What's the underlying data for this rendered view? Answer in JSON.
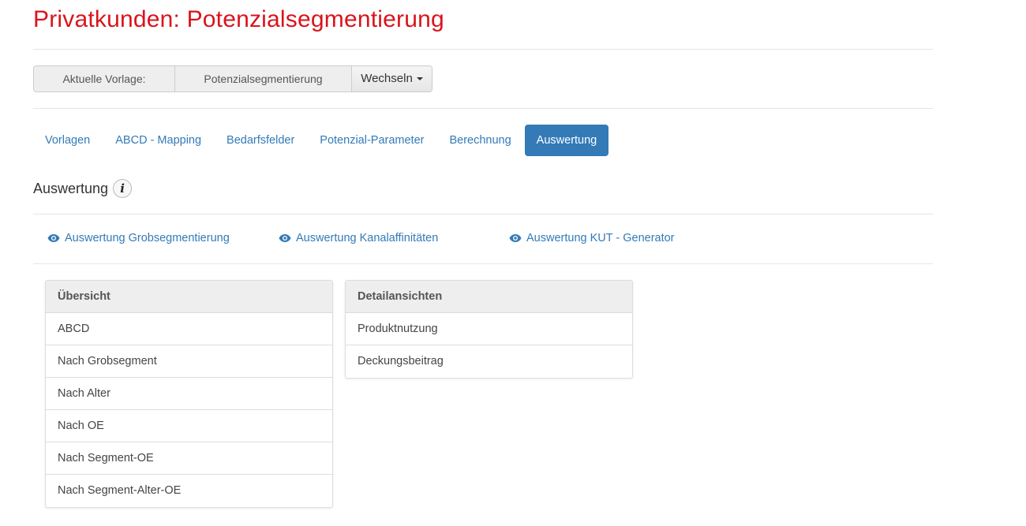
{
  "page_title": "Privatkunden: Potenzialsegmentierung",
  "template": {
    "label": "Aktuelle Vorlage:",
    "value": "Potenzialsegmentierung",
    "switch_label": "Wechseln"
  },
  "nav": {
    "items": [
      {
        "label": "Vorlagen",
        "active": false
      },
      {
        "label": "ABCD - Mapping",
        "active": false
      },
      {
        "label": "Bedarfsfelder",
        "active": false
      },
      {
        "label": "Potenzial-Parameter",
        "active": false
      },
      {
        "label": "Berechnung",
        "active": false
      },
      {
        "label": "Auswertung",
        "active": true
      }
    ]
  },
  "section": {
    "title": "Auswertung",
    "info_icon": "i"
  },
  "links": [
    {
      "label": "Auswertung Grobsegmentierung",
      "icon": "eye-icon"
    },
    {
      "label": "Auswertung Kanalaffinitäten",
      "icon": "eye-icon"
    },
    {
      "label": "Auswertung KUT - Generator",
      "icon": "eye-icon"
    }
  ],
  "overview": {
    "heading": "Übersicht",
    "items": [
      "ABCD",
      "Nach Grobsegment",
      "Nach Alter",
      "Nach OE",
      "Nach Segment-OE",
      "Nach Segment-Alter-OE"
    ]
  },
  "details": {
    "heading": "Detailansichten",
    "items": [
      "Produktnutzung",
      "Deckungsbeitrag"
    ]
  },
  "colors": {
    "title": "#d9141c",
    "accent": "#337ab7"
  }
}
